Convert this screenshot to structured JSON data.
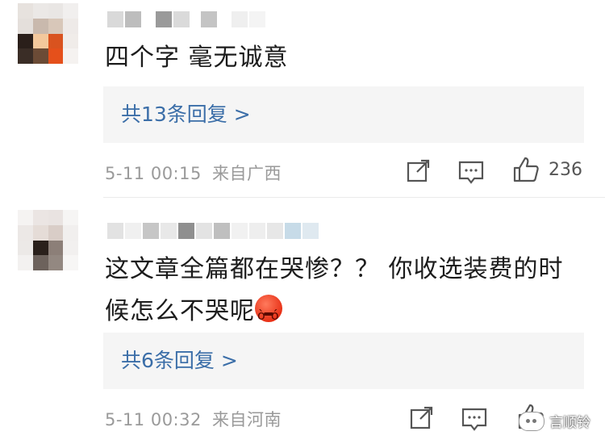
{
  "comments": [
    {
      "text_lines": [
        "四个字 毫无诚意"
      ],
      "reply_link": "共13条回复 >",
      "timestamp": "5-11 00:15",
      "location": "来自广西",
      "like_count": "236"
    },
    {
      "text_lines": [
        "这文章全篇都在哭惨？？ 你收选装费的时",
        "候怎么不哭呢"
      ],
      "reply_link": "共6条回复 >",
      "timestamp": "5-11 00:32",
      "location": "来自河南",
      "like_count": ""
    }
  ],
  "icons": {
    "share": "share-icon",
    "comment": "comment-icon",
    "like": "thumbs-up-icon",
    "emoji": "angry-face-emoji-icon",
    "watermark_logo": "wechat-logo-icon"
  },
  "colors": {
    "reply_link": "#3b6ea8",
    "meta_text": "#9a9a9a",
    "reply_box_bg": "#f5f5f5"
  },
  "watermark": {
    "text": "言顺铃"
  }
}
